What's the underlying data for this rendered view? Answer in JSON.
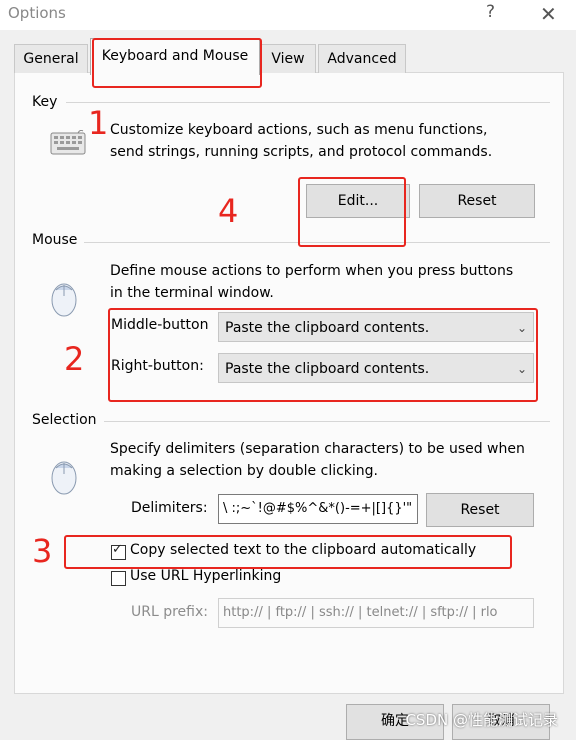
{
  "window": {
    "title": "Options",
    "help_glyph": "?",
    "close_glyph": "✕"
  },
  "tabs": [
    {
      "label": "General"
    },
    {
      "label": "Keyboard and Mouse"
    },
    {
      "label": "View"
    },
    {
      "label": "Advanced"
    }
  ],
  "key": {
    "group": "Key",
    "desc_line1": "Customize keyboard actions, such as menu functions,",
    "desc_line2": "send strings, running scripts,  and protocol commands.",
    "edit_label": "Edit...",
    "reset_label": "Reset"
  },
  "mouse": {
    "group": "Mouse",
    "desc_line1": "Define mouse actions to perform when you press buttons",
    "desc_line2": "in the terminal window.",
    "middle_label": "Middle-button",
    "middle_value": "Paste the clipboard contents.",
    "right_label": "Right-button:",
    "right_value": "Paste the clipboard contents."
  },
  "selection": {
    "group": "Selection",
    "desc_line1": "Specify delimiters (separation characters) to be used when",
    "desc_line2": "making a selection by double clicking.",
    "delimiters_label": "Delimiters:",
    "delimiters_value": "\\ :;~`!@#$%^&*()-=+|[]{}'\"",
    "reset_label": "Reset",
    "copy_label": "Copy selected text to the clipboard automatically",
    "copy_checked": true,
    "url_label": "Use URL Hyperlinking",
    "url_checked": false,
    "url_prefix_label": "URL prefix:",
    "url_prefix_value": "http:// | ftp:// | ssh:// | telnet:// | sftp:// | rlo"
  },
  "annotations": {
    "n1": "1",
    "n2": "2",
    "n3": "3",
    "n4": "4"
  },
  "footer": {
    "ok_label": "确定",
    "cancel_label": "取消"
  },
  "watermark": "CSDN @性能测试记录",
  "colors": {
    "annotation_red": "#e8261f",
    "panel_bg": "#fbfbfb"
  }
}
